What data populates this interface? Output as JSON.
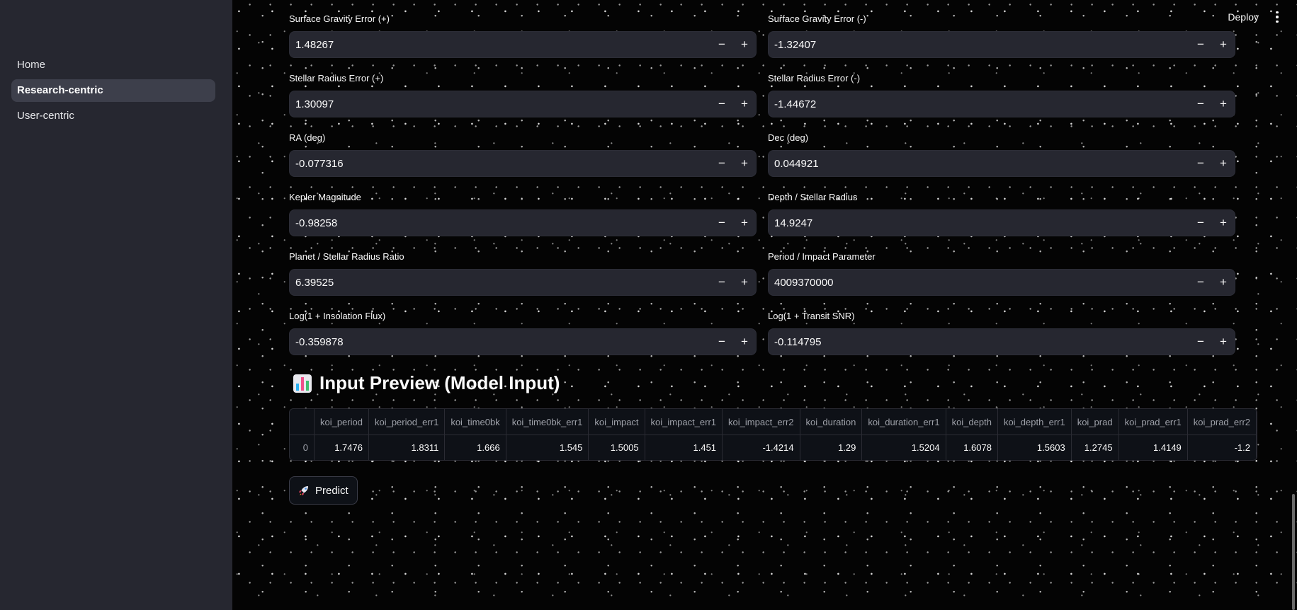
{
  "sidebar": {
    "items": [
      {
        "label": "Home",
        "active": false
      },
      {
        "label": "Research-centric",
        "active": true
      },
      {
        "label": "User-centric",
        "active": false
      }
    ]
  },
  "header": {
    "deploy_label": "Deploy",
    "menu_icon": "more-vert-icon"
  },
  "fields": {
    "surface_gravity_err_pos": {
      "label": "Surface Gravity Error (+)",
      "value": "1.48267"
    },
    "surface_gravity_err_neg": {
      "label": "Surface Gravity Error (-)",
      "value": "-1.32407"
    },
    "stellar_radius_err_pos": {
      "label": "Stellar Radius Error (+)",
      "value": "1.30097"
    },
    "stellar_radius_err_neg": {
      "label": "Stellar Radius Error (-)",
      "value": "-1.44672"
    },
    "ra": {
      "label": "RA (deg)",
      "value": "-0.077316"
    },
    "dec": {
      "label": "Dec (deg)",
      "value": "0.044921"
    },
    "kepler_mag": {
      "label": "Kepler Magnitude",
      "value": "-0.98258"
    },
    "depth_stellar_radius": {
      "label": "Depth / Stellar Radius",
      "value": "14.9247"
    },
    "planet_stellar_ratio": {
      "label": "Planet / Stellar Radius Ratio",
      "value": "6.39525"
    },
    "period_impact": {
      "label": "Period / Impact Parameter",
      "value": "4009370000"
    },
    "log_insolation": {
      "label": "Log(1 + Insolation Flux)",
      "value": "-0.359878"
    },
    "log_snr": {
      "label": "Log(1 + Transit SNR)",
      "value": "-0.114795"
    }
  },
  "stepper": {
    "minus": "−",
    "plus": "+"
  },
  "preview": {
    "title": "Input Preview (Model Input)",
    "icon": "bar-chart-icon",
    "columns": [
      "koi_period",
      "koi_period_err1",
      "koi_time0bk",
      "koi_time0bk_err1",
      "koi_impact",
      "koi_impact_err1",
      "koi_impact_err2",
      "koi_duration",
      "koi_duration_err1",
      "koi_depth",
      "koi_depth_err1",
      "koi_prad",
      "koi_prad_err1",
      "koi_prad_err2"
    ],
    "row_index": "0",
    "row": [
      "1.7476",
      "1.8311",
      "1.666",
      "1.545",
      "1.5005",
      "1.451",
      "-1.4214",
      "1.29",
      "1.5204",
      "1.6078",
      "1.5603",
      "1.2745",
      "1.4149",
      "-1.2"
    ]
  },
  "predict": {
    "label": "Predict",
    "icon": "rocket-icon"
  },
  "colors": {
    "sidebar": "#262730",
    "input": "#262730",
    "text": "#fafafa"
  }
}
